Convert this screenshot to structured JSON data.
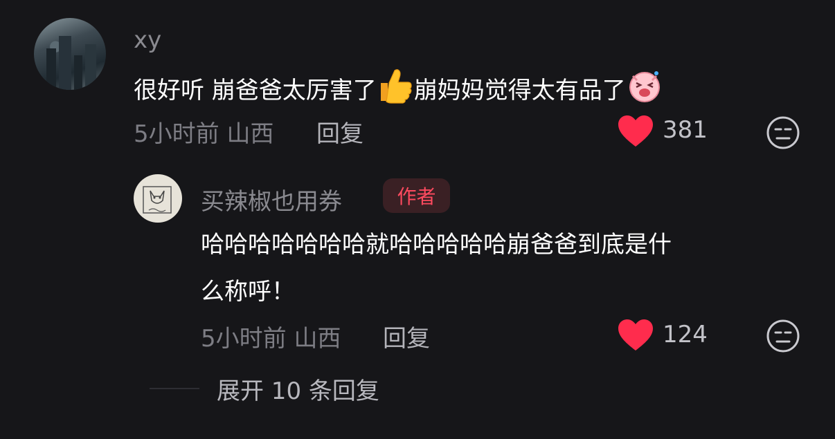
{
  "comment": {
    "username": "xy",
    "text_part1": "很好听 崩爸爸太厉害了",
    "text_part2": "崩妈妈觉得太有品了",
    "emoji1": "thumbs-up-emoji",
    "emoji2": "laughing-pig-emoji",
    "time_location": "5小时前 山西",
    "reply_label": "回复",
    "like_count": "381"
  },
  "reply": {
    "username": "买辣椒也用券",
    "author_badge": "作者",
    "text_line1": "哈哈哈哈哈哈哈就哈哈哈哈哈崩爸爸到底是什",
    "text_line2": "么称呼！",
    "time_location": "5小时前 山西",
    "reply_label": "回复",
    "like_count": "124"
  },
  "expand": {
    "label": "展开 10 条回复"
  },
  "colors": {
    "background": "#161619",
    "like_heart": "#ff2c4d",
    "author_badge_text": "#ff4a5f"
  }
}
